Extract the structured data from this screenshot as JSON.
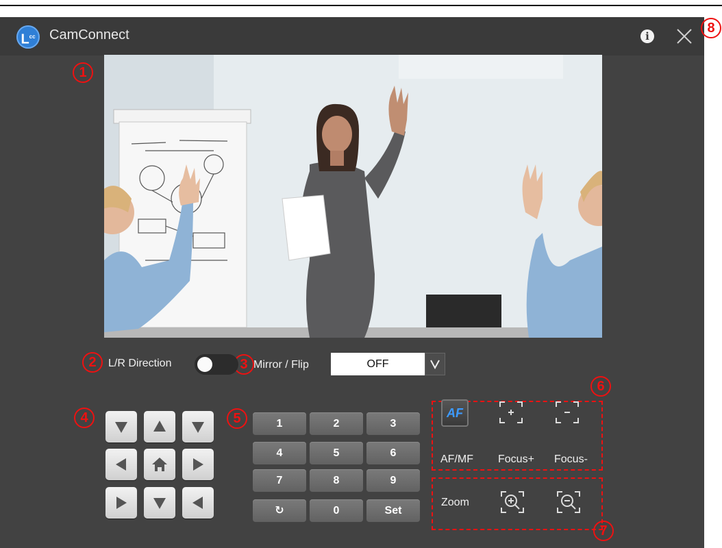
{
  "app": {
    "title": "CamConnect",
    "logo_letter": "L"
  },
  "markers": [
    "1",
    "2",
    "3",
    "4",
    "5",
    "6",
    "7",
    "8"
  ],
  "controls": {
    "lr_direction_label": "L/R Direction",
    "mirror_flip_label": "Mirror / Flip",
    "mirror_flip_value": "OFF",
    "mirror_flip_arrow": "V"
  },
  "keypad": {
    "rows": [
      [
        "1",
        "2",
        "3"
      ],
      [
        "4",
        "5",
        "6"
      ],
      [
        "7",
        "8",
        "9"
      ],
      [
        "↻",
        "0",
        "Set"
      ]
    ]
  },
  "focus": {
    "af_mark": "AF",
    "af_label": "AF/MF",
    "focus_plus_label": "Focus+",
    "focus_minus_label": "Focus-"
  },
  "zoom": {
    "label": "Zoom"
  },
  "colors": {
    "annotation": "#ee1111",
    "app_bg": "#424242",
    "titlebar": "#3a3a3a",
    "af_text": "#3d9bff"
  }
}
